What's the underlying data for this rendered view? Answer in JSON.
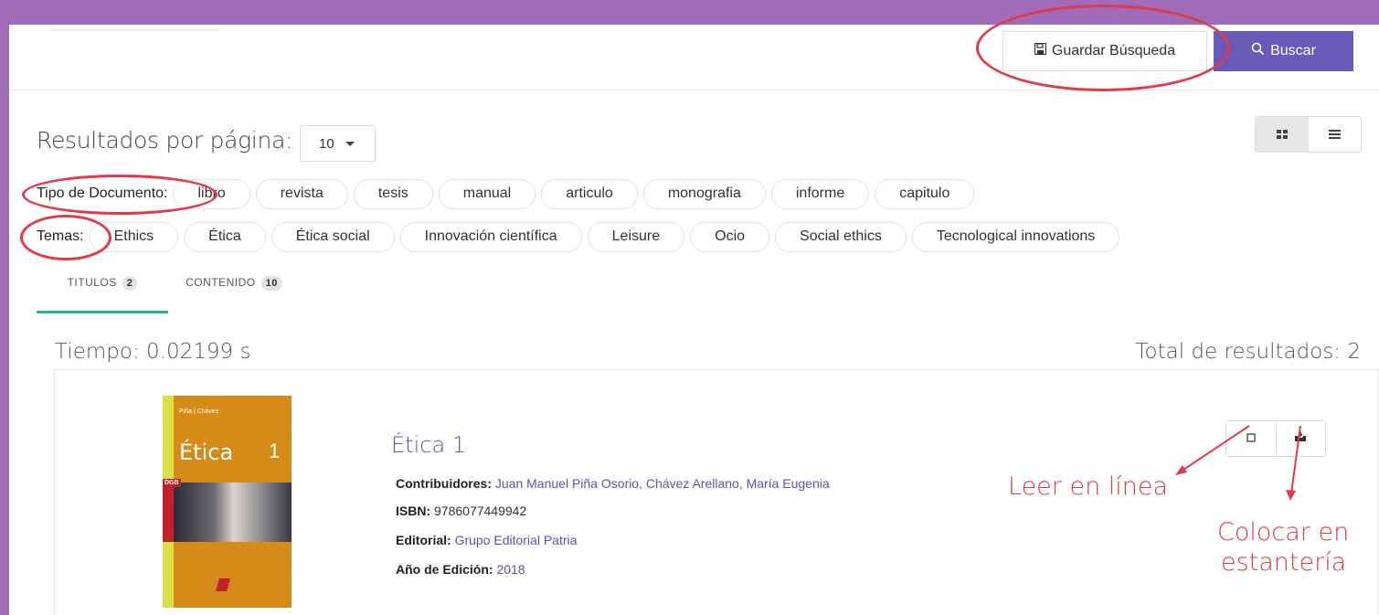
{
  "header": {
    "save_label": "Guardar Búsqueda",
    "search_label": "Buscar",
    "save_icon": "floppy-disk-icon",
    "search_icon": "search-icon"
  },
  "results_per_page": {
    "label": "Resultados por página:",
    "value": "10"
  },
  "view_modes": [
    "grid",
    "list"
  ],
  "filters": {
    "document_type": {
      "label": "Tipo de Documento:",
      "chips": [
        "libro",
        "revista",
        "tesis",
        "manual",
        "articulo",
        "monografia",
        "informe",
        "capitulo"
      ]
    },
    "topics": {
      "label": "Temas:",
      "chips": [
        "Ethics",
        "Ética",
        "Ética social",
        "Innovación científica",
        "Leisure",
        "Ocio",
        "Social ethics",
        "Tecnological innovations"
      ]
    }
  },
  "tabs": [
    {
      "label": "TITULOS",
      "count": "2"
    },
    {
      "label": "CONTENIDO",
      "count": "10"
    }
  ],
  "summary": {
    "time": "Tiempo: 0.02199 s",
    "total": "Total de resultados: 2"
  },
  "result": {
    "title": "Ética 1",
    "cover": {
      "authors": "Piña | Chávez",
      "title": "Ética",
      "number": "1",
      "badge": "DGB"
    },
    "contributors_label": "Contribuidores:",
    "contributors": "Juan Manuel Piña Osorio, Chávez Arellano, María Eugenia",
    "isbn_label": "ISBN:",
    "isbn": "9786077449942",
    "publisher_label": "Editorial:",
    "publisher": "Grupo Editorial Patria",
    "year_label": "Año de Edición:",
    "year": "2018",
    "action_icons": [
      "book-open-icon",
      "shelf-inbox-icon"
    ]
  },
  "annotations": {
    "read_online": "Leer en línea",
    "shelf_line1": "Colocar en",
    "shelf_line2": "estantería",
    "color": "#e03c48"
  }
}
